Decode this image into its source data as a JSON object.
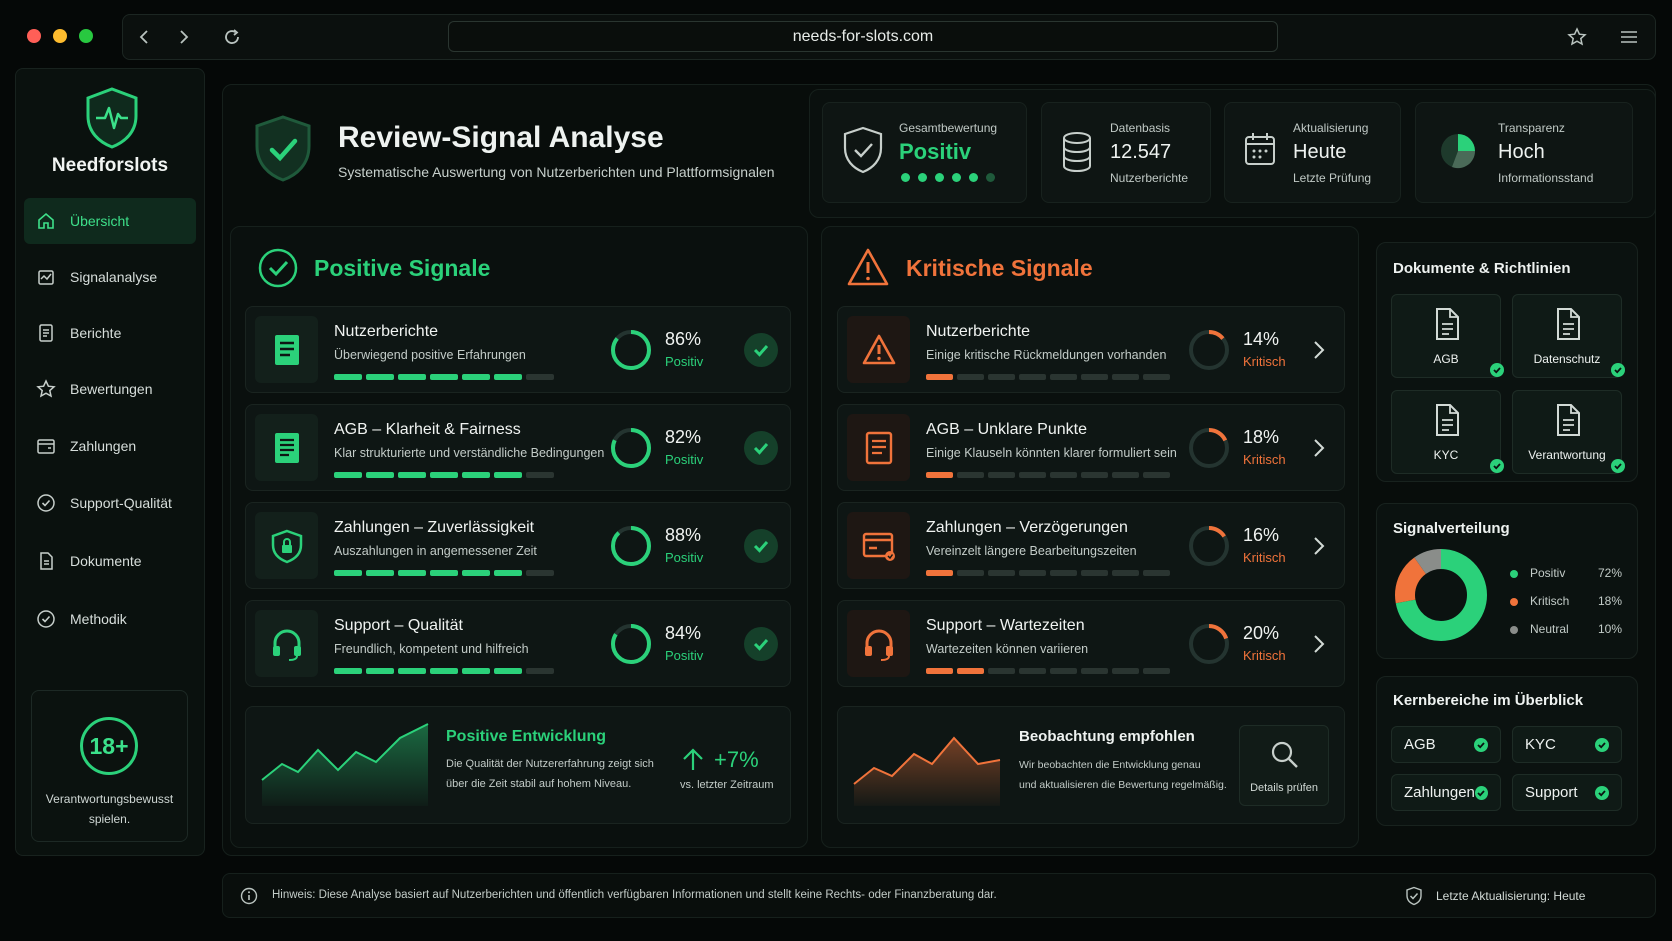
{
  "browser": {
    "url": "needs-for-slots.com",
    "colors": {
      "close": "#ff5f57",
      "minimize": "#febc2e",
      "maximize": "#28c840"
    }
  },
  "sidebar": {
    "brand": "Needforslots",
    "items": [
      {
        "label": "Übersicht",
        "icon": "home-icon",
        "active": true
      },
      {
        "label": "Signalanalyse",
        "icon": "signal-icon"
      },
      {
        "label": "Berichte",
        "icon": "report-icon"
      },
      {
        "label": "Bewertungen",
        "icon": "star-icon"
      },
      {
        "label": "Zahlungen",
        "icon": "wallet-icon"
      },
      {
        "label": "Support-Qualität",
        "icon": "support-check-icon"
      },
      {
        "label": "Dokumente",
        "icon": "document-icon"
      },
      {
        "label": "Methodik",
        "icon": "check-circle-icon"
      }
    ],
    "age": {
      "badge": "18+",
      "text": "Verantwortungsbewusst spielen."
    }
  },
  "header": {
    "title": "Review-Signal Analyse",
    "subtitle": "Systematische Auswertung von Nutzerberichten und Plattformsignalen"
  },
  "stats": {
    "overall": {
      "label": "Gesamtbewertung",
      "value": "Positiv",
      "rating_filled": 5,
      "rating_total": 6
    },
    "database": {
      "label": "Datenbasis",
      "value": "12.547",
      "sub": "Nutzerberichte"
    },
    "update": {
      "label": "Aktualisierung",
      "value": "Heute",
      "sub": "Letzte Prüfung"
    },
    "transparency": {
      "label": "Transparenz",
      "value": "Hoch",
      "sub": "Informationsstand"
    }
  },
  "positive": {
    "title": "Positive Signale",
    "status_label": "Positiv",
    "items": [
      {
        "title": "Nutzerberichte",
        "desc": "Überwiegend positive Erfahrungen",
        "pct": "86%",
        "value": 86
      },
      {
        "title": "AGB – Klarheit & Fairness",
        "desc": "Klar strukturierte und verständliche Bedingungen",
        "pct": "82%",
        "value": 82
      },
      {
        "title": "Zahlungen – Zuverlässigkeit",
        "desc": "Auszahlungen in angemessener Zeit",
        "pct": "88%",
        "value": 88
      },
      {
        "title": "Support – Qualität",
        "desc": "Freundlich, kompetent und hilfreich",
        "pct": "84%",
        "value": 84
      }
    ],
    "trend": {
      "title": "Positive Entwicklung",
      "text1": "Die Qualität der Nutzererfahrung zeigt sich",
      "text2": "über die Zeit stabil auf hohem Niveau.",
      "delta": "+7%",
      "delta_sub": "vs. letzter Zeitraum"
    }
  },
  "critical": {
    "title": "Kritische Signale",
    "status_label": "Kritisch",
    "items": [
      {
        "title": "Nutzerberichte",
        "desc": "Einige kritische Rückmeldungen vorhanden",
        "pct": "14%",
        "value": 14
      },
      {
        "title": "AGB – Unklare Punkte",
        "desc": "Einige Klauseln könnten klarer formuliert sein",
        "pct": "18%",
        "value": 18
      },
      {
        "title": "Zahlungen – Verzögerungen",
        "desc": "Vereinzelt längere Bearbeitungszeiten",
        "pct": "16%",
        "value": 16
      },
      {
        "title": "Support – Wartezeiten",
        "desc": "Wartezeiten können variieren",
        "pct": "20%",
        "value": 20
      }
    ],
    "watch": {
      "title": "Beobachtung empfohlen",
      "text1": "Wir beobachten die Entwicklung genau",
      "text2": "und aktualisieren die Bewertung regelmäßig.",
      "button": "Details prüfen"
    }
  },
  "documents": {
    "title": "Dokumente & Richtlinien",
    "items": [
      "AGB",
      "Datenschutz",
      "KYC",
      "Verantwortung"
    ]
  },
  "distribution": {
    "title": "Signalverteilung",
    "legend": [
      {
        "label": "Positiv",
        "pct": "72%",
        "value": 72,
        "color": "#2bd17a"
      },
      {
        "label": "Kritisch",
        "pct": "18%",
        "value": 18,
        "color": "#f0733b"
      },
      {
        "label": "Neutral",
        "pct": "10%",
        "value": 10,
        "color": "#8a8d8a"
      }
    ]
  },
  "core": {
    "title": "Kernbereiche im Überblick",
    "items": [
      "AGB",
      "KYC",
      "Zahlungen",
      "Support"
    ]
  },
  "footer": {
    "note": "Hinweis: Diese Analyse basiert auf Nutzerberichten und öffentlich verfügbaren Informationen und stellt keine Rechts- oder Finanzberatung dar.",
    "updated": "Letzte Aktualisierung: Heute"
  },
  "colors": {
    "green": "#2bd17a",
    "orange": "#f0733b"
  }
}
